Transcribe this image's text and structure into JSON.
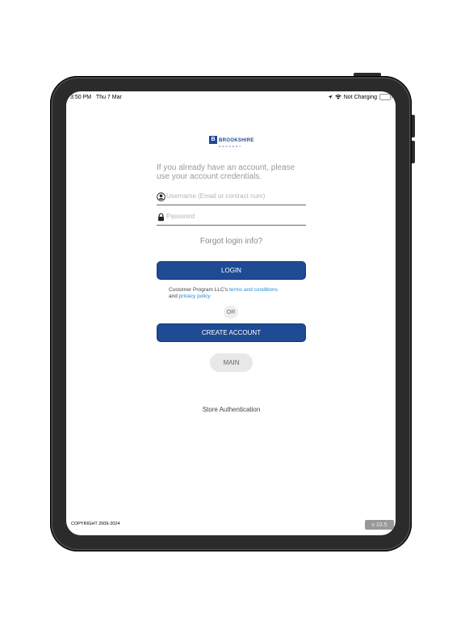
{
  "status_bar": {
    "time": "3:50 PM",
    "date": "Thu 7 Mar",
    "battery_text": "Not Charging"
  },
  "logo": {
    "mark": "B",
    "name": "BROOKSHIRE",
    "sub": "GROCERY"
  },
  "login": {
    "intro": "If you already have an account, please use your account credentials.",
    "username_placeholder": "Username (Email or contract num)",
    "password_placeholder": "Password",
    "forgot": "Forgot login info?",
    "login_button": "LOGIN",
    "terms_prefix": "Customer Program LLC's",
    "terms_link": "terms and conditions",
    "and": "and",
    "privacy_link": "privacy policy",
    "or": "OR",
    "create_button": "CREATE ACCOUNT",
    "main_button": "MAIN",
    "store_auth": "Store Authentication"
  },
  "footer": {
    "copyright": "COPYRIGHT 2009-2024",
    "version": "v 10.5"
  },
  "colors": {
    "primary": "#1f4a94",
    "link": "#1f8ad6",
    "device": "#2b2b2b"
  }
}
